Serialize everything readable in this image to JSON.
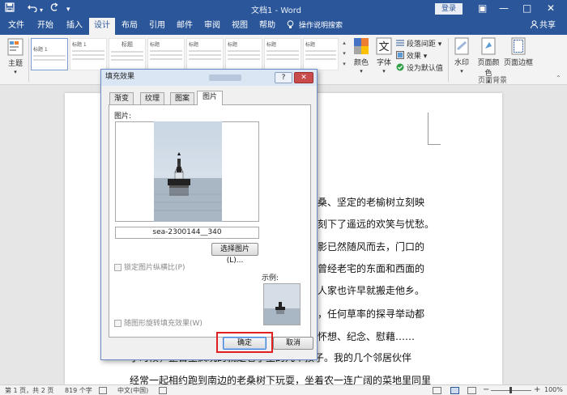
{
  "window": {
    "title": "文档1 - Word",
    "login_label": "登录",
    "title_color": "#2b579a"
  },
  "quick_access": {
    "save_icon": "save-icon",
    "undo_icon": "undo-icon",
    "redo_icon": "redo-icon",
    "customize_icon": "customize-quick-access-icon"
  },
  "window_controls": {
    "ribbon_display": "▣",
    "minimize": "—",
    "restore": "□",
    "close": "✕"
  },
  "ribbon_tabs": [
    {
      "label": "文件"
    },
    {
      "label": "开始"
    },
    {
      "label": "插入"
    },
    {
      "label": "设计",
      "active": true
    },
    {
      "label": "布局"
    },
    {
      "label": "引用"
    },
    {
      "label": "邮件"
    },
    {
      "label": "审阅"
    },
    {
      "label": "视图"
    },
    {
      "label": "帮助"
    }
  ],
  "tell_me": "操作说明搜索",
  "share_label": "共享",
  "ribbon": {
    "theme_label": "主题",
    "style_gallery": [
      {
        "title": ""
      },
      {
        "title": "标题 1"
      },
      {
        "title": "标题"
      },
      {
        "title": "标题"
      },
      {
        "title": "标题"
      },
      {
        "title": "标题"
      },
      {
        "title": "标题"
      },
      {
        "title": "标题"
      }
    ],
    "colors_label": "颜色",
    "fonts_label": "字体",
    "paragraph_spacing_label": "段落间距",
    "effects_label": "效果",
    "set_default_label": "设为默认值",
    "watermark_label": "水印",
    "page_color_label": "页面颜色",
    "page_border_label": "页面边框",
    "page_background_group": "页面背景"
  },
  "document": {
    "lines": [
      "桑、坚定的老榆树立刻映",
      "刻下了遥远的欢笑与忧愁。",
      "影已然随风而去，门口的",
      "曾经老宅的东面和西面的",
      "人家也许早就搬走他乡。",
      "，任何草率的探寻举动都",
      "怀想、纪念、慰藉……",
      "小时候，整日里疯玩的就是巷子里的几个孩子。我的几个邻居伙伴",
      "经常一起相约跑到南边的老桑树下玩耍，坐着农一连广阔的菜地里同里"
    ]
  },
  "dialog": {
    "title": "填充效果",
    "help_label": "?",
    "close_label": "✕",
    "tabs": [
      {
        "label": "渐变"
      },
      {
        "label": "纹理"
      },
      {
        "label": "图案"
      },
      {
        "label": "图片",
        "active": true
      }
    ],
    "picture_label": "图片:",
    "filename": "sea-2300144__340",
    "select_button": "选择图片(L)...",
    "lock_ratio_label": "锁定图片纵横比(P)",
    "sample_label": "示例:",
    "rotate_label": "随图形旋转填充效果(W)",
    "ok_label": "确定",
    "cancel_label": "取消"
  },
  "status": {
    "page": "第 1 页，共 2 页",
    "words": "819 个字",
    "language": "中文(中国)",
    "zoom": "100%"
  }
}
